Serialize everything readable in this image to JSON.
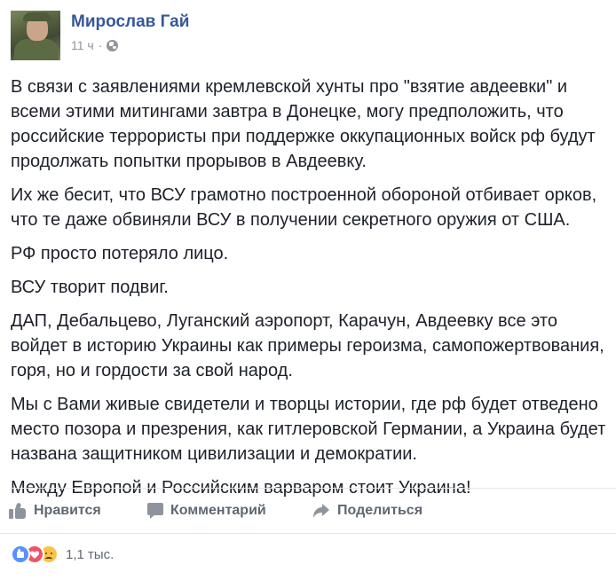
{
  "post": {
    "author": "Мирослав Гай",
    "timestamp": "11 ч",
    "separator": "·",
    "privacy_icon": "globe-icon",
    "paragraphs": [
      "В связи с заявлениями кремлевской хунты про \"взятие авдеевки\" и всеми этими митингами завтра в Донецке, могу предположить, что российские террористы при поддержке оккупационных войск рф будут продолжать попытки прорывов в Авдеевку.",
      "Их же бесит, что ВСУ грамотно построенной обороной отбивает орков, что те даже обвиняли ВСУ в получении секретного оружия от США.",
      "РФ просто потеряло лицо.",
      "ВСУ творит подвиг.",
      "ДАП, Дебальцево, Луганский аэропорт, Карачун, Авдеевку все это войдет в историю Украины как примеры героизма, самопожертвования, горя, но и гордости за свой народ.",
      "Мы с Вами живые свидетели и творцы истории, где рф будет отведено место позора и презрения, как гитлеровской Германии, а Украина будет названа защитником цивилизации и демократии.",
      "Между Европой и Российским варваром стоит Украина!"
    ]
  },
  "actions": {
    "like_label": "Нравится",
    "comment_label": "Комментарий",
    "share_label": "Поделиться"
  },
  "reactions": {
    "types": [
      "like",
      "love",
      "sad"
    ],
    "count": "1,1 тыс."
  },
  "colors": {
    "author_link": "#365899",
    "meta_gray": "#90949c",
    "action_gray": "#606770",
    "like_blue": "#5890ff",
    "love_red": "#f25268",
    "sad_yellow": "#f7c546"
  }
}
